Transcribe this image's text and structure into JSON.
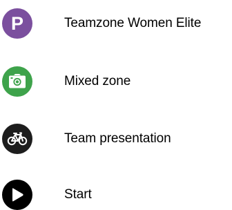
{
  "legend": {
    "items": [
      {
        "id": "teamzone",
        "label": "Teamzone Women Elite",
        "icon": "parking-icon",
        "icon_text": "P",
        "color": "#7b4f9e"
      },
      {
        "id": "mixed-zone",
        "label": "Mixed zone",
        "icon": "camera-icon",
        "color": "#3ea34b"
      },
      {
        "id": "team-presentation",
        "label": "Team presentation",
        "icon": "bicycle-icon",
        "color": "#1d1d1d"
      },
      {
        "id": "start",
        "label": "Start",
        "icon": "play-icon",
        "color": "#000000"
      }
    ]
  }
}
